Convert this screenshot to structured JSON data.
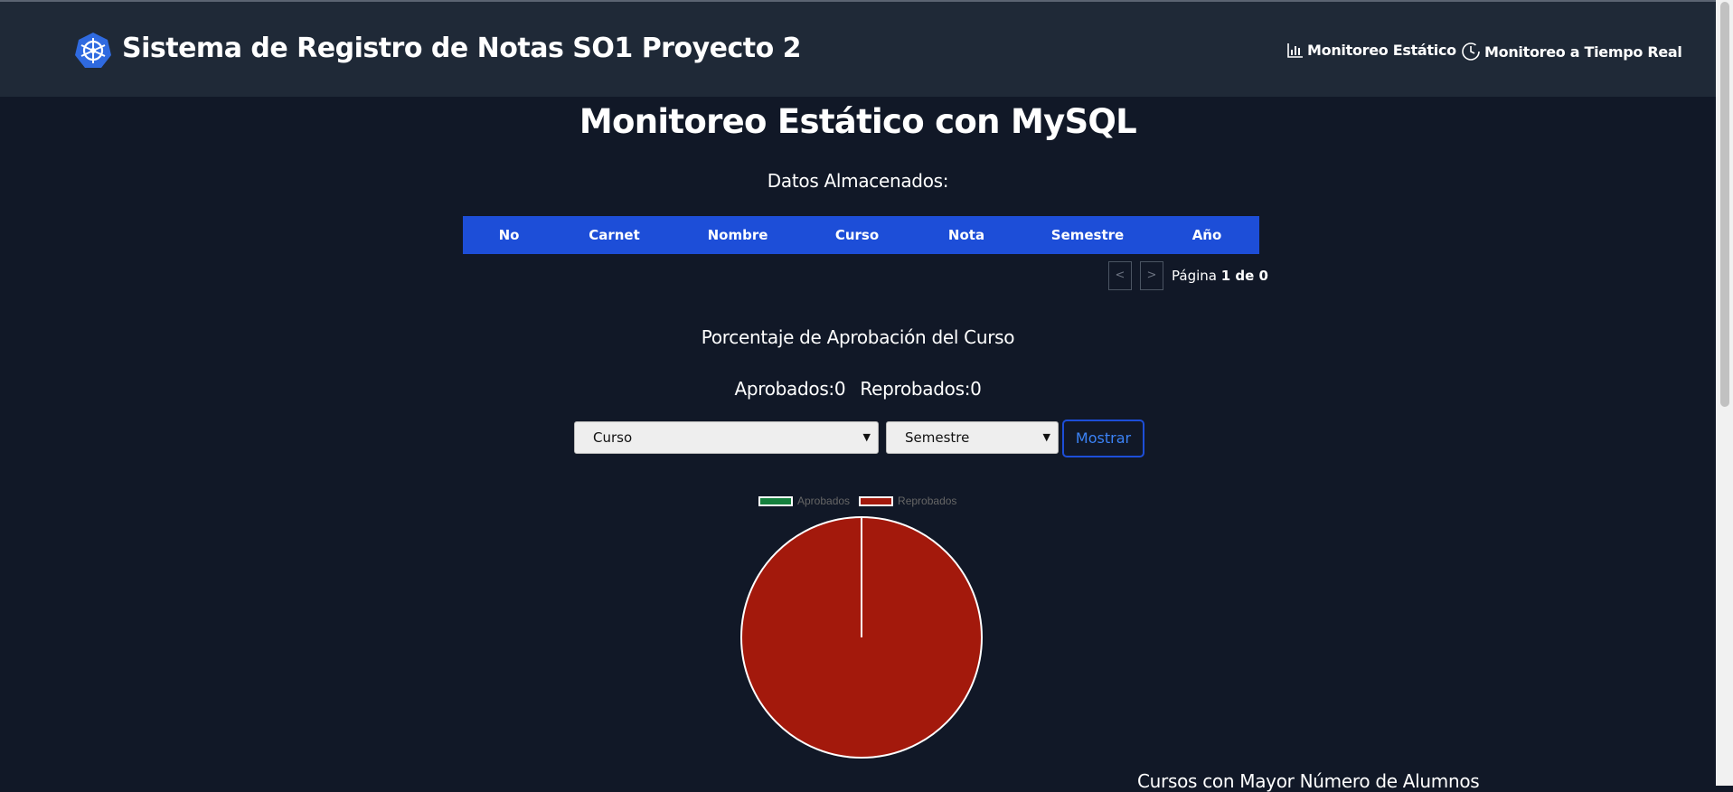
{
  "navbar": {
    "title": "Sistema de Registro de Notas SO1 Proyecto 2",
    "links": [
      {
        "label": "Monitoreo Estático",
        "icon": "bar-chart-icon"
      },
      {
        "label": "Monitoreo a Tiempo Real",
        "icon": "clock-icon"
      }
    ]
  },
  "main": {
    "title": "Monitoreo Estático con MySQL",
    "stored_heading": "Datos Almacenados:",
    "table": {
      "columns": [
        "No",
        "Carnet",
        "Nombre",
        "Curso",
        "Nota",
        "Semestre",
        "Año"
      ],
      "rows": []
    },
    "pagination": {
      "prev": "<",
      "next": ">",
      "page_label": "Página",
      "page_value": "1 de 0"
    },
    "approval_heading": "Porcentaje de Aprobación del Curso",
    "approved_text": "Aprobados:0",
    "failed_text": "Reprobados:0",
    "course_select": "Curso",
    "semester_select": "Semestre",
    "show_button": "Mostrar",
    "bottom_heading": "Cursos con Mayor Número de Alumnos"
  },
  "colors": {
    "navbar_bg": "#1f2937",
    "page_bg": "#111827",
    "accent": "#1d4ed8",
    "approved": "#15803d",
    "failed": "#a3190c"
  },
  "chart_data": {
    "type": "pie",
    "categories": [
      "Aprobados",
      "Reprobados"
    ],
    "values": [
      0,
      100
    ],
    "legend": "top"
  }
}
